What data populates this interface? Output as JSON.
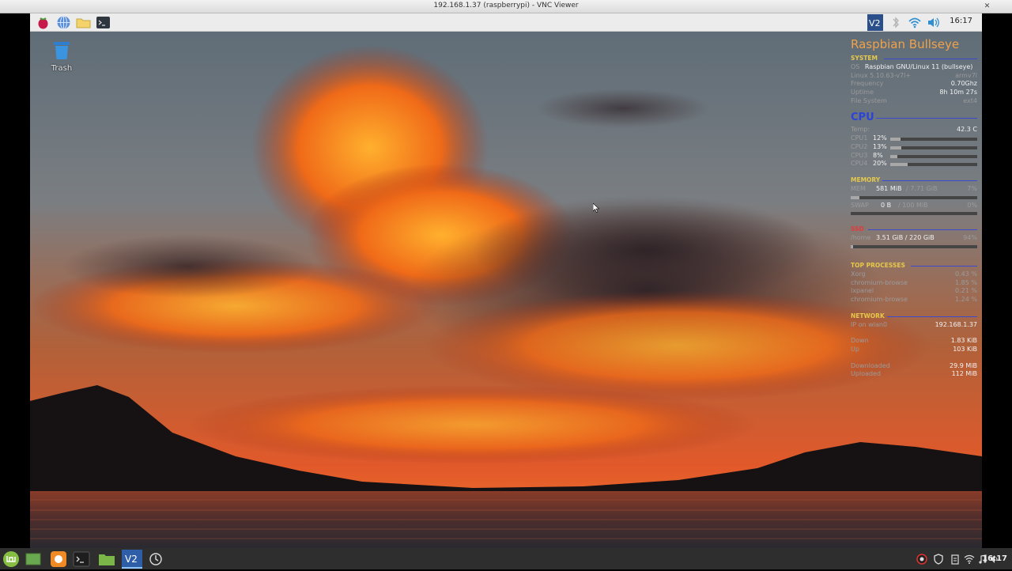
{
  "window": {
    "title": "192.168.1.37 (raspberrypi) - VNC Viewer"
  },
  "remote_panel": {
    "launchers": [
      "raspberry-menu-icon",
      "web-browser-icon",
      "file-manager-icon",
      "terminal-icon"
    ],
    "tray": [
      "vnc-server-icon",
      "bluetooth-icon",
      "wifi-icon",
      "volume-icon"
    ],
    "clock": "16:17"
  },
  "desktop": {
    "trash_label": "Trash"
  },
  "conky": {
    "title": "Raspbian Bullseye",
    "system": {
      "label": "SYSTEM",
      "os_label": "OS",
      "os_value": "Raspbian GNU/Linux 11 (bullseye)",
      "kernel": "Linux 5.10.63-v7l+",
      "arch": "armv7l",
      "frequency_label": "Frequency",
      "frequency_value": "0.70Ghz",
      "uptime_label": "Uptime",
      "uptime_value": "8h 10m 27s",
      "fs_label": "File System",
      "fs_value": "ext4"
    },
    "cpu": {
      "label": "CPU",
      "temp_label": "Temp:",
      "temp_value": "42.3 C",
      "cores": [
        {
          "name": "CPU1",
          "usage": "12%",
          "fraction": 0.12
        },
        {
          "name": "CPU2",
          "usage": "13%",
          "fraction": 0.13
        },
        {
          "name": "CPU3",
          "usage": "8%",
          "fraction": 0.08
        },
        {
          "name": "CPU4",
          "usage": "20%",
          "fraction": 0.2
        }
      ]
    },
    "memory": {
      "label": "MEMORY",
      "mem_label": "MEM",
      "mem_used": "581 MiB",
      "mem_total": "/ 7.71 GiB",
      "mem_percent": "7%",
      "mem_fraction": 0.07,
      "swap_label": "SWAP",
      "swap_used": "0 B",
      "swap_total": "/ 100 MiB",
      "swap_percent": "0%",
      "swap_fraction": 0.0
    },
    "ssd": {
      "label": "SSD",
      "mount": "/home",
      "usage": "3.51 GiB / 220 GiB",
      "percent": "94%",
      "fraction": 0.016
    },
    "top_processes": {
      "label": "TOP PROCESSES",
      "items": [
        {
          "name": "Xorg",
          "value": "0.43 %"
        },
        {
          "name": "chromium-browse",
          "value": "1.85 %"
        },
        {
          "name": "lxpanel",
          "value": "0.21 %"
        },
        {
          "name": "chromium-browse",
          "value": "1.24 %"
        }
      ]
    },
    "network": {
      "label": "NETWORK",
      "ip_label": "IP on wlan0",
      "ip_value": "192.168.1.37",
      "down_label": "Down",
      "down_value": "1.83 KiB",
      "up_label": "Up",
      "up_value": "103 KiB",
      "downloaded_label": "Downloaded",
      "downloaded_value": "29.9 MiB",
      "uploaded_label": "Uploaded",
      "uploaded_value": "112 MiB"
    }
  },
  "taskbar": {
    "apps": [
      "mint-menu-icon",
      "show-desktop-icon",
      "firefox-icon",
      "terminal-icon",
      "files-icon",
      "vscode-icon",
      "timeshift-icon"
    ],
    "tray": [
      "opera-icon",
      "shield-icon",
      "clipboard-icon",
      "wifi-icon",
      "music-icon",
      "volume-icon"
    ],
    "clock": "16:17"
  },
  "colors": {
    "accent_orange": "#f0a24a",
    "section_yellow": "#e6c84a",
    "cpu_blue": "#2b43d8",
    "ssd_red": "#e23b3b"
  }
}
